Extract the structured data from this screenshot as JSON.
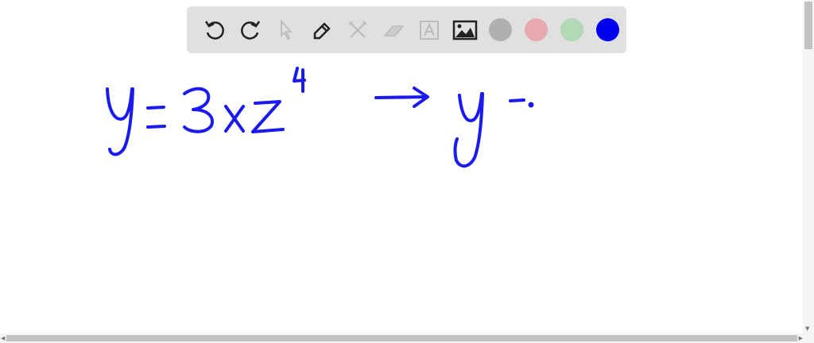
{
  "toolbar": {
    "tools": [
      "undo",
      "redo",
      "select",
      "pen",
      "tools",
      "eraser",
      "text",
      "image"
    ],
    "colors": {
      "gray": "#b0b0b0",
      "pink": "#e8a9ae",
      "green": "#b2d8b5",
      "blue": "#0000ee"
    },
    "selected_color": "blue"
  },
  "ink": {
    "color": "#1a1aee"
  }
}
